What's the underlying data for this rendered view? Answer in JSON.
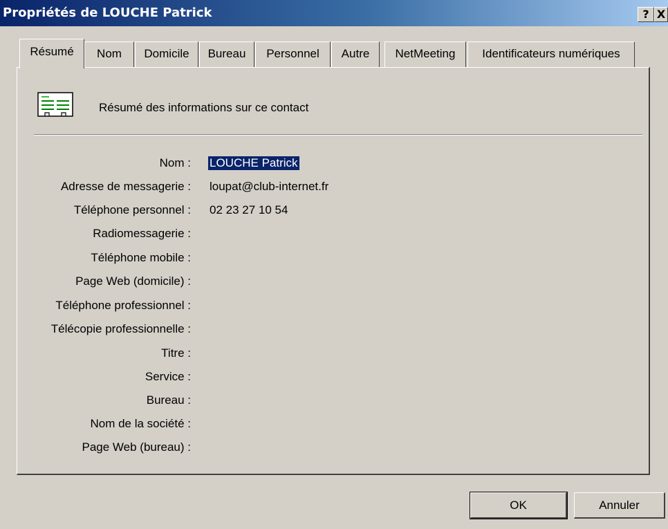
{
  "window": {
    "title": "Propriétés de LOUCHE Patrick",
    "help_label": "?",
    "close_label": "X"
  },
  "tabs": [
    {
      "label": "Résumé",
      "active": true
    },
    {
      "label": "Nom"
    },
    {
      "label": "Domicile"
    },
    {
      "label": "Bureau"
    },
    {
      "label": "Personnel"
    },
    {
      "label": "Autre"
    },
    {
      "label": "NetMeeting"
    },
    {
      "label": "Identificateurs numériques"
    }
  ],
  "summary": {
    "heading": "Résumé des informations sur ce contact",
    "icon": "contact-card-icon",
    "fields": [
      {
        "label": "Nom :",
        "value": "LOUCHE Patrick"
      },
      {
        "label": "Adresse de messagerie :",
        "value": "loupat@club-internet.fr"
      },
      {
        "label": "Téléphone personnel :",
        "value": "02 23 27 10 54"
      },
      {
        "label": "Radiomessagerie :",
        "value": ""
      },
      {
        "label": "Téléphone mobile :",
        "value": ""
      },
      {
        "label": "Page Web (domicile) :",
        "value": ""
      },
      {
        "label": "Téléphone professionnel :",
        "value": ""
      },
      {
        "label": "Télécopie professionnelle :",
        "value": ""
      },
      {
        "label": "Titre :",
        "value": ""
      },
      {
        "label": "Service :",
        "value": ""
      },
      {
        "label": "Bureau :",
        "value": ""
      },
      {
        "label": "Nom de la société :",
        "value": ""
      },
      {
        "label": "Page Web (bureau) :",
        "value": ""
      }
    ]
  },
  "buttons": {
    "ok": "OK",
    "cancel": "Annuler"
  },
  "colors": {
    "title_bar": "#0a246a",
    "face": "#d4d0c8",
    "selection": "#0a246a"
  }
}
